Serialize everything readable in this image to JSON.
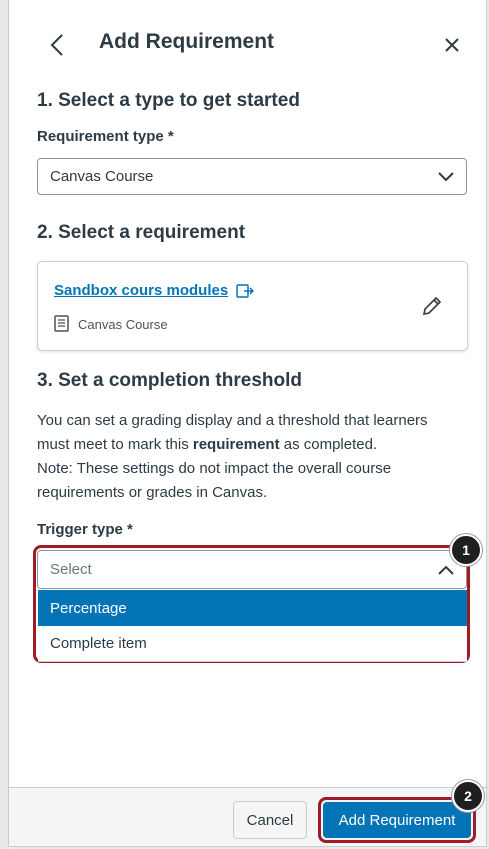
{
  "header": {
    "title": "Add Requirement"
  },
  "step1": {
    "heading": "1. Select a type to get started",
    "type_label": "Requirement type *",
    "type_value": "Canvas Course"
  },
  "step2": {
    "heading": "2. Select a requirement",
    "card": {
      "link_text": "Sandbox cours modules",
      "meta_text": "Canvas Course"
    }
  },
  "step3": {
    "heading": "3. Set a completion threshold",
    "para_line1_a": "You can set a grading display and a threshold that learners must meet to mark this ",
    "para_bold": "requirement",
    "para_line1_b": " as completed.",
    "para_line2": "Note: These settings do not impact the overall course requirements or grades in Canvas.",
    "trigger_label": "Trigger type *",
    "trigger_placeholder": "Select",
    "options": [
      "Percentage",
      "Complete item"
    ]
  },
  "footer": {
    "cancel_label": "Cancel",
    "add_label": "Add Requirement"
  },
  "badges": [
    "1",
    "2"
  ],
  "colors": {
    "accent": "#0374b5",
    "highlight": "#9e1b27",
    "text": "#2d3b45"
  }
}
